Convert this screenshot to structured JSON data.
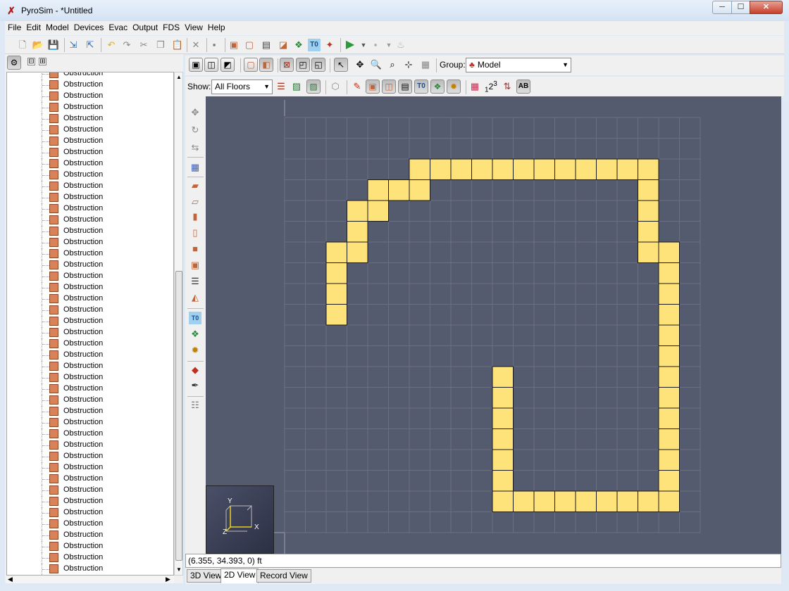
{
  "window": {
    "title": "PyroSim - *Untitled",
    "controls": {
      "minimize": "─",
      "maximize": "☐",
      "close": "✕"
    }
  },
  "menu": [
    "File",
    "Edit",
    "Model",
    "Devices",
    "Evac",
    "Output",
    "FDS",
    "View",
    "Help"
  ],
  "toolbar_icons": [
    "new-file-icon",
    "open-folder-icon",
    "save-icon",
    "import-icon",
    "export-icon",
    "undo-icon",
    "redo-icon",
    "cut-icon",
    "copy-icon",
    "paste-icon",
    "delete-icon",
    "properties-icon",
    "new-obstruction-icon",
    "new-hole-icon",
    "new-vent-icon",
    "new-slice-icon",
    "new-device-icon",
    "new-text-icon",
    "new-surface-icon",
    "run-simulation-icon",
    "dropdown-icon",
    "stop-icon",
    "dropdown-icon",
    "fire-icon"
  ],
  "tree": {
    "header_buttons": [
      "⊟",
      "⊞"
    ],
    "item_label": "Obstruction",
    "items_count_visible": 45
  },
  "view_toolbar": {
    "group_label": "Group:",
    "group_value": "Model"
  },
  "show_toolbar": {
    "show_label": "Show:",
    "floor_value": "All Floors",
    "labels_number": "1",
    "labels_superscript": "2",
    "labels_sup2": "3",
    "ab_label": "AB",
    "t0_label": "T0"
  },
  "left_tools_icons": [
    "move-icon",
    "rotate-icon",
    "mirror-icon",
    "mesh-icon",
    "slab-icon",
    "floor-icon",
    "wall-icon",
    "wall2-icon",
    "block-icon",
    "room-icon",
    "script-icon",
    "roof-icon",
    "text-icon",
    "particles-icon",
    "fire-device-icon",
    "paint-icon",
    "eyedropper-icon",
    "list-icon"
  ],
  "axes": {
    "y": "Y",
    "x": "X",
    "z": "Z"
  },
  "status_text": "(6.355, 34.393, 0) ft",
  "tabs": [
    {
      "label": "3D View",
      "active": false
    },
    {
      "label": "2D View",
      "active": true
    },
    {
      "label": "Record View",
      "active": false
    }
  ],
  "colors": {
    "obstruction_fill": "#fde37a",
    "viewport_bg": "#555b6e",
    "grid_line": "#6a7083"
  }
}
